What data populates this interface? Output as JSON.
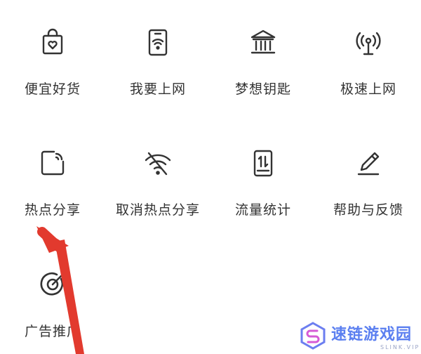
{
  "menu": {
    "items": [
      {
        "label": "便宜好货",
        "icon": "shopping-bag-heart-icon"
      },
      {
        "label": "我要上网",
        "icon": "phone-wifi-icon"
      },
      {
        "label": "梦想钥匙",
        "icon": "bank-building-icon"
      },
      {
        "label": "极速上网",
        "icon": "signal-tower-icon"
      },
      {
        "label": "热点分享",
        "icon": "hotspot-share-icon"
      },
      {
        "label": "取消热点分享",
        "icon": "wifi-off-icon"
      },
      {
        "label": "流量统计",
        "icon": "data-usage-icon"
      },
      {
        "label": "帮助与反馈",
        "icon": "pen-feedback-icon"
      },
      {
        "label": "广告推广",
        "icon": "target-icon"
      }
    ]
  },
  "watermark": {
    "name": "速链游戏园",
    "sub": "SLINK.VIP",
    "icon": "hexagon-s-logo-icon"
  },
  "colors": {
    "icon_stroke": "#333333",
    "arrow": "#e23a2e",
    "watermark": "#5b7ff0"
  }
}
